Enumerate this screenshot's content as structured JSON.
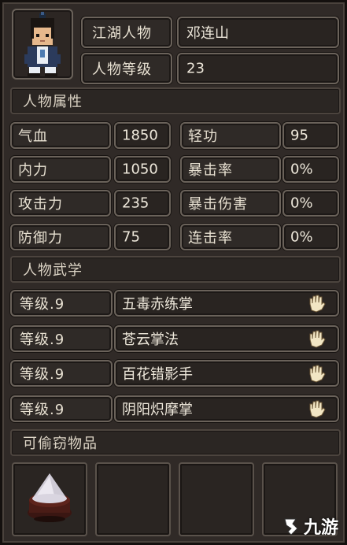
{
  "character": {
    "name_label": "江湖人物",
    "name": "邓连山",
    "level_label": "人物等级",
    "level": "23"
  },
  "attributes": {
    "section_title": "人物属性",
    "items": [
      {
        "label": "气血",
        "value": "1850"
      },
      {
        "label": "轻功",
        "value": "95"
      },
      {
        "label": "内力",
        "value": "1050"
      },
      {
        "label": "暴击率",
        "value": "0%"
      },
      {
        "label": "攻击力",
        "value": "235"
      },
      {
        "label": "暴击伤害",
        "value": "0%"
      },
      {
        "label": "防御力",
        "value": "75"
      },
      {
        "label": "连击率",
        "value": "0%"
      }
    ]
  },
  "martial": {
    "section_title": "人物武学",
    "skills": [
      {
        "level": "等级.9",
        "name": "五毒赤练掌",
        "icon": "palm-icon"
      },
      {
        "level": "等级.9",
        "name": "苍云掌法",
        "icon": "palm-icon"
      },
      {
        "level": "等级.9",
        "name": "百花错影手",
        "icon": "palm-icon"
      },
      {
        "level": "等级.9",
        "name": "阴阳炽摩掌",
        "icon": "palm-icon"
      }
    ]
  },
  "steal": {
    "section_title": "可偷窃物品",
    "slots": [
      {
        "icon": "salt-bowl-icon"
      },
      {
        "icon": ""
      },
      {
        "icon": ""
      },
      {
        "icon": ""
      }
    ]
  },
  "watermark": {
    "text": "九游"
  },
  "colors": {
    "panel_bg": "#302a27",
    "box_border": "#6a625a",
    "text": "#e9e2d4"
  }
}
